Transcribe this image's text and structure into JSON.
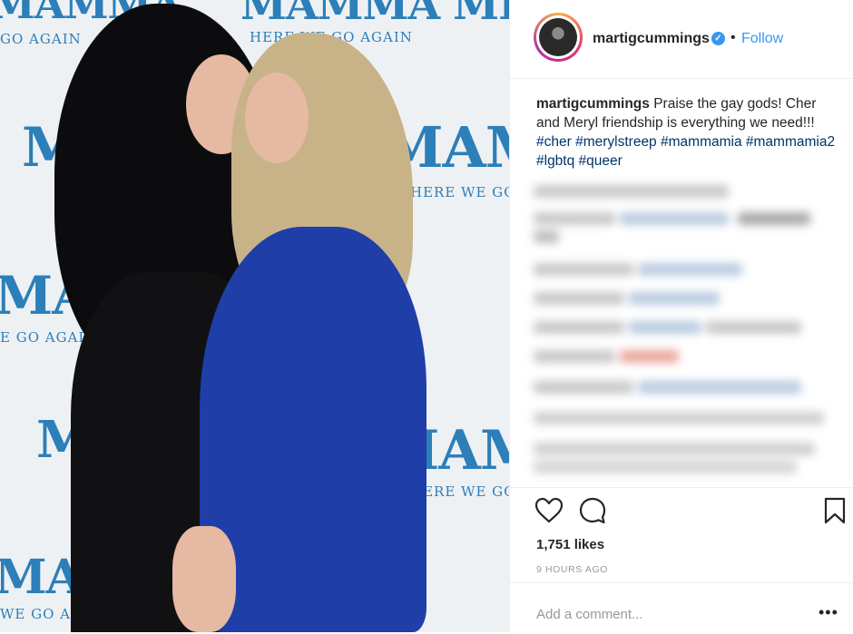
{
  "backdrop": {
    "mamma": "MAMMA",
    "mammamia": "MAMMA MIA!",
    "here_we_go": "HERE WE GO",
    "here_we_go_again": "HERE WE GO AGAIN",
    "go_again": "GO AGAIN",
    "e_go_again": "E GO AGAIN",
    "we_go_again": "WE GO AGAI"
  },
  "post": {
    "username": "martigcummings",
    "verified_icon": "verified-badge-icon",
    "separator": "•",
    "follow_label": "Follow",
    "caption": {
      "username": "martigcummings",
      "text": " Praise the gay gods! Cher and Meryl friendship is everything we need!!! ",
      "hashtags": [
        "#cher",
        "#merylstreep",
        "#mammamia",
        "#mammamia2",
        "#lgbtq",
        "#queer"
      ]
    },
    "likes": "1,751 likes",
    "time_ago": "9 HOURS AGO",
    "comment_placeholder": "Add a comment...",
    "more_label": "•••"
  },
  "icons": {
    "like": "heart-icon",
    "comment": "comment-bubble-icon",
    "save": "bookmark-icon",
    "more": "more-options-icon"
  },
  "colors": {
    "accent": "#3897f0",
    "hashtag": "#003569",
    "muted": "#999999",
    "backdrop_blue": "#2c7fb8",
    "dress_blue": "#1f3ea8"
  }
}
